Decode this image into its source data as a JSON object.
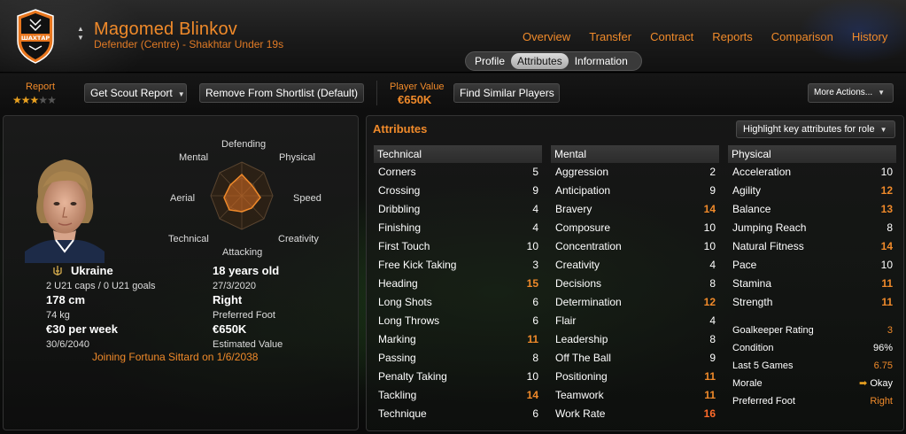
{
  "header": {
    "player_name": "Magomed Blinkov",
    "subtitle": "Defender (Centre) - Shakhtar Under 19s",
    "club_badge_text": "ШАХТАР",
    "nav": [
      "Overview",
      "Transfer",
      "Contract",
      "Reports",
      "Comparison",
      "History"
    ],
    "sub_tabs": [
      "Profile",
      "Attributes",
      "Information"
    ],
    "active_sub_tab": "Attributes",
    "accent_color": "#f08a2a"
  },
  "toolbar": {
    "report_label": "Report",
    "report_stars": 2.5,
    "report_stars_max": 5,
    "get_scout_report": "Get Scout Report",
    "remove_shortlist": "Remove From Shortlist (Default)",
    "player_value_label": "Player Value",
    "player_value": "€650K",
    "find_similar": "Find Similar Players",
    "more_actions": "More Actions..."
  },
  "profile": {
    "radar_labels": {
      "defending": "Defending",
      "physical": "Physical",
      "speed": "Speed",
      "creativity": "Creativity",
      "attacking": "Attacking",
      "technical": "Technical",
      "aerial": "Aerial",
      "mental": "Mental"
    },
    "nationality": "Ukraine",
    "caps": "2 U21 caps / 0 U21 goals",
    "age": "18 years old",
    "dob": "27/3/2020",
    "height": "178 cm",
    "weight": "74 kg",
    "preferred_foot": "Right",
    "preferred_foot_label": "Preferred Foot",
    "wage": "€30 per week",
    "contract_end": "30/6/2040",
    "estimated_value": "€650K",
    "estimated_value_label": "Estimated Value",
    "joining_note": "Joining Fortuna Sittard on 1/6/2038"
  },
  "attributes": {
    "title": "Attributes",
    "highlight_button": "Highlight key attributes for role",
    "technical": {
      "header": "Technical",
      "rows": [
        {
          "name": "Corners",
          "value": "5"
        },
        {
          "name": "Crossing",
          "value": "9"
        },
        {
          "name": "Dribbling",
          "value": "4"
        },
        {
          "name": "Finishing",
          "value": "4"
        },
        {
          "name": "First Touch",
          "value": "10"
        },
        {
          "name": "Free Kick Taking",
          "value": "3"
        },
        {
          "name": "Heading",
          "value": "15"
        },
        {
          "name": "Long Shots",
          "value": "6"
        },
        {
          "name": "Long Throws",
          "value": "6"
        },
        {
          "name": "Marking",
          "value": "11"
        },
        {
          "name": "Passing",
          "value": "8"
        },
        {
          "name": "Penalty Taking",
          "value": "10"
        },
        {
          "name": "Tackling",
          "value": "14"
        },
        {
          "name": "Technique",
          "value": "6"
        }
      ]
    },
    "mental": {
      "header": "Mental",
      "rows": [
        {
          "name": "Aggression",
          "value": "2"
        },
        {
          "name": "Anticipation",
          "value": "9"
        },
        {
          "name": "Bravery",
          "value": "14"
        },
        {
          "name": "Composure",
          "value": "10"
        },
        {
          "name": "Concentration",
          "value": "10"
        },
        {
          "name": "Creativity",
          "value": "4"
        },
        {
          "name": "Decisions",
          "value": "8"
        },
        {
          "name": "Determination",
          "value": "12"
        },
        {
          "name": "Flair",
          "value": "4"
        },
        {
          "name": "Leadership",
          "value": "8"
        },
        {
          "name": "Off The Ball",
          "value": "9"
        },
        {
          "name": "Positioning",
          "value": "11"
        },
        {
          "name": "Teamwork",
          "value": "11"
        },
        {
          "name": "Work Rate",
          "value": "16"
        }
      ]
    },
    "physical": {
      "header": "Physical",
      "rows": [
        {
          "name": "Acceleration",
          "value": "10"
        },
        {
          "name": "Agility",
          "value": "12"
        },
        {
          "name": "Balance",
          "value": "13"
        },
        {
          "name": "Jumping Reach",
          "value": "8"
        },
        {
          "name": "Natural Fitness",
          "value": "14"
        },
        {
          "name": "Pace",
          "value": "10"
        },
        {
          "name": "Stamina",
          "value": "11"
        },
        {
          "name": "Strength",
          "value": "11"
        }
      ]
    },
    "misc": {
      "goalkeeper_rating_label": "Goalkeeper Rating",
      "goalkeeper_rating": "3",
      "condition_label": "Condition",
      "condition": "96%",
      "last5_label": "Last 5 Games",
      "last5": "6.75",
      "morale_label": "Morale",
      "morale": "Okay",
      "pref_foot_label": "Preferred Foot",
      "pref_foot": "Right"
    }
  }
}
